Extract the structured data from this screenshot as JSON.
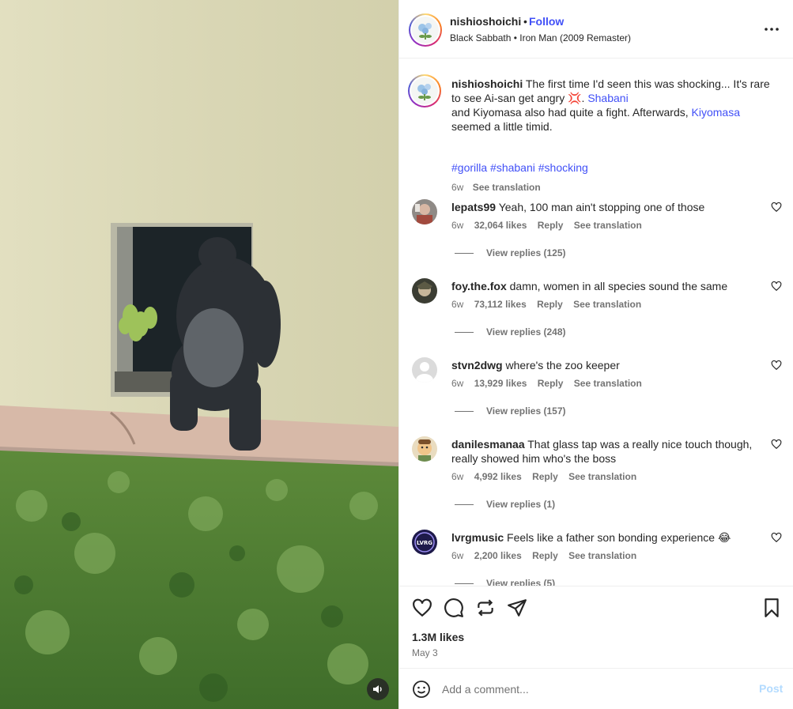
{
  "media": {
    "audio_icon": "speaker-icon"
  },
  "header": {
    "username": "nishioshoichi",
    "separator": "•",
    "follow_label": "Follow",
    "audio": "Black Sabbath • Iron Man (2009 Remaster)",
    "more_icon": "ellipsis-icon"
  },
  "caption": {
    "username": "nishioshoichi",
    "text_1": "The first time I'd seen this was shocking... It's rare to see Ai-san get angry",
    "emoji_1": "💢",
    "text_2": ".",
    "mention_1": "Shabani",
    "text_3": "and Kiyomasa also had quite a fight. Afterwards,",
    "mention_2": "Kiyomasa",
    "text_4": "seemed a little timid.",
    "hashtags": "#gorilla #shabani #shocking",
    "time": "6w",
    "see_translation": "See translation"
  },
  "comments": [
    {
      "username": "lepats99",
      "text": "Yeah, 100 man ain't stopping one of those",
      "time": "6w",
      "likes": "32,064 likes",
      "reply": "Reply",
      "see_translation": "See translation",
      "view_replies": "View replies (125)"
    },
    {
      "username": "foy.the.fox",
      "text": "damn, women in all species sound the same",
      "time": "6w",
      "likes": "73,112 likes",
      "reply": "Reply",
      "see_translation": "See translation",
      "view_replies": "View replies (248)"
    },
    {
      "username": "stvn2dwg",
      "text": "where's the zoo keeper",
      "time": "6w",
      "likes": "13,929 likes",
      "reply": "Reply",
      "see_translation": "See translation",
      "view_replies": "View replies (157)"
    },
    {
      "username": "danilesmanaa",
      "text": "That glass tap was a really nice touch though, really showed him who's the boss",
      "time": "6w",
      "likes": "4,992 likes",
      "reply": "Reply",
      "see_translation": "See translation",
      "view_replies": "View replies (1)"
    },
    {
      "username": "lvrgmusic",
      "text": "Feels like a father son bonding experience 😂",
      "time": "6w",
      "likes": "2,200 likes",
      "reply": "Reply",
      "see_translation": "See translation",
      "view_replies": "View replies (5)",
      "avatar_text": "LVRG"
    }
  ],
  "actions": {
    "likes": "1.3M likes",
    "date": "May 3"
  },
  "add_comment": {
    "placeholder": "Add a comment...",
    "post_label": "Post"
  },
  "colors": {
    "link": "#4150f7",
    "muted": "#737373",
    "post_disabled": "#b3dbff"
  }
}
